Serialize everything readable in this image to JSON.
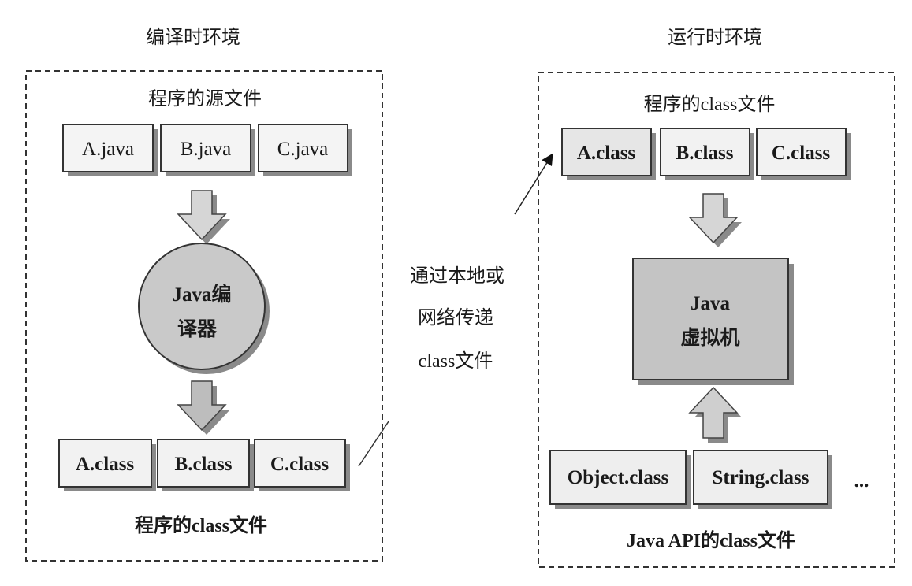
{
  "compile_env": {
    "title": "编译时环境",
    "source_label": "程序的源文件",
    "source_files": [
      "A.java",
      "B.java",
      "C.java"
    ],
    "compiler_line1": "Java编",
    "compiler_line2": "译器",
    "class_files": [
      "A.class",
      "B.class",
      "C.class"
    ],
    "class_label": "程序的class文件"
  },
  "transfer": {
    "line1": "通过本地或",
    "line2": "网络传递",
    "line3": "class文件"
  },
  "runtime_env": {
    "title": "运行时环境",
    "class_label": "程序的class文件",
    "class_files": [
      "A.class",
      "B.class",
      "C.class"
    ],
    "jvm_line1": "Java",
    "jvm_line2": "虚拟机",
    "api_files": [
      "Object.class",
      "String.class"
    ],
    "ellipsis": "...",
    "api_label": "Java API的class文件"
  },
  "colors": {
    "box_fill": "#f2f2f2",
    "shape_fill": "#c8c8c8",
    "shadow": "#8a8a8a",
    "border": "#333333"
  }
}
